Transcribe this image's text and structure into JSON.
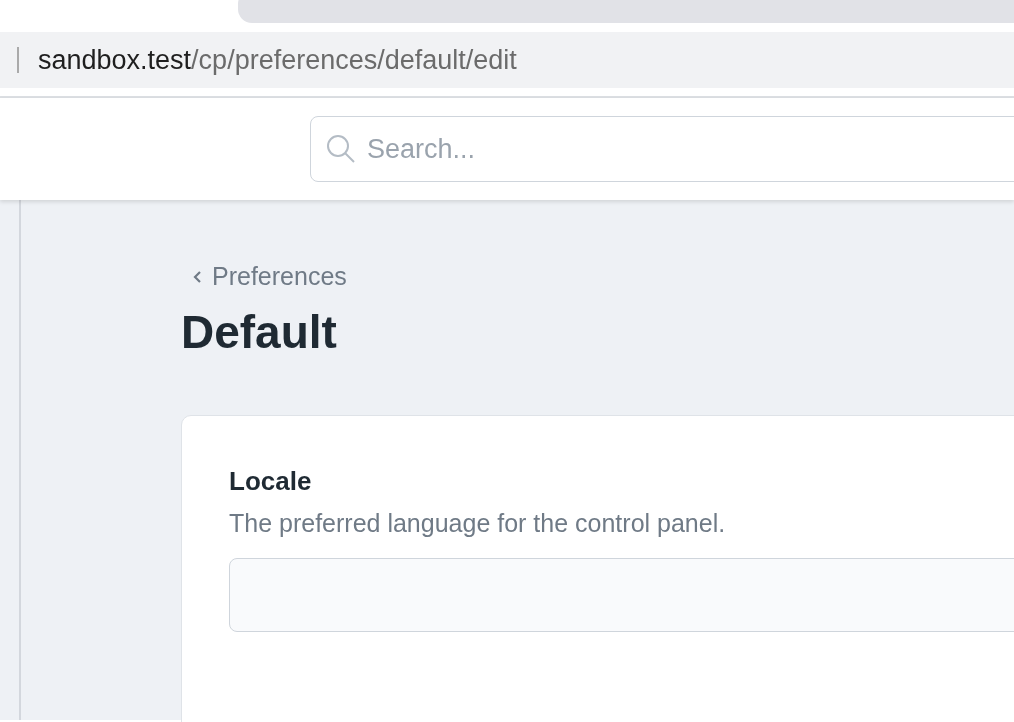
{
  "address_bar": {
    "host": "sandbox.test",
    "path": "/cp/preferences/default/edit"
  },
  "search": {
    "placeholder": "Search..."
  },
  "breadcrumb": {
    "label": "Preferences"
  },
  "page_title": "Default",
  "fields": [
    {
      "kind": "text",
      "label": "Locale",
      "description": "The preferred language for the control panel."
    }
  ]
}
